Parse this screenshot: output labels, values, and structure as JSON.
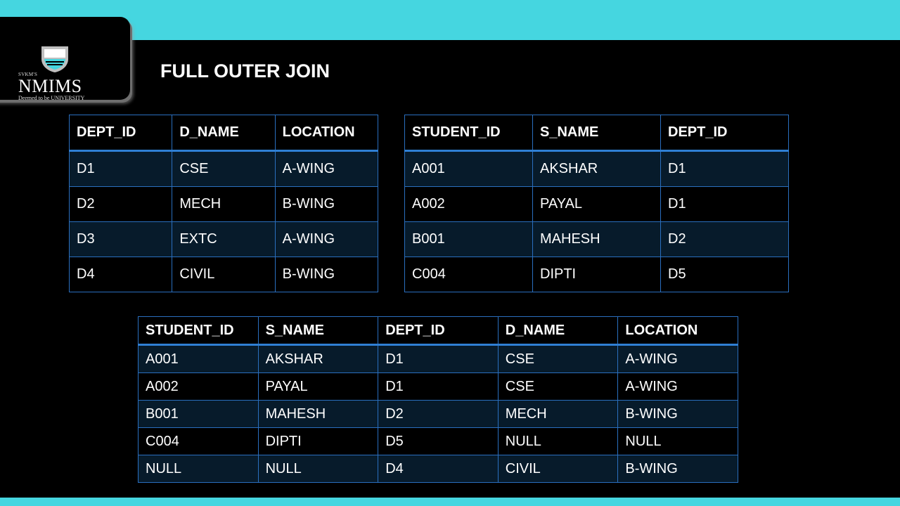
{
  "logo": {
    "svkm": "SVKM'S",
    "name": "NMIMS",
    "tagline": "Deemed to be UNIVERSITY"
  },
  "title": "FULL OUTER JOIN",
  "dept_table": {
    "headers": [
      "DEPT_ID",
      "D_NAME",
      "LOCATION"
    ],
    "rows": [
      [
        "D1",
        "CSE",
        "A-WING"
      ],
      [
        "D2",
        "MECH",
        "B-WING"
      ],
      [
        "D3",
        "EXTC",
        "A-WING"
      ],
      [
        "D4",
        "CIVIL",
        "B-WING"
      ]
    ]
  },
  "student_table": {
    "headers": [
      "STUDENT_ID",
      "S_NAME",
      "DEPT_ID"
    ],
    "rows": [
      [
        "A001",
        "AKSHAR",
        "D1"
      ],
      [
        "A002",
        "PAYAL",
        "D1"
      ],
      [
        "B001",
        "MAHESH",
        "D2"
      ],
      [
        "C004",
        "DIPTI",
        "D5"
      ]
    ]
  },
  "result_table": {
    "headers": [
      "STUDENT_ID",
      "S_NAME",
      "DEPT_ID",
      "D_NAME",
      "LOCATION"
    ],
    "rows": [
      [
        "A001",
        "AKSHAR",
        "D1",
        "CSE",
        "A-WING"
      ],
      [
        "A002",
        "PAYAL",
        "D1",
        "CSE",
        "A-WING"
      ],
      [
        "B001",
        "MAHESH",
        "D2",
        "MECH",
        "B-WING"
      ],
      [
        "C004",
        "DIPTI",
        "D5",
        "NULL",
        "NULL"
      ],
      [
        "NULL",
        "NULL",
        "D4",
        "CIVIL",
        "B-WING"
      ]
    ]
  },
  "colors": {
    "accent": "#45d6e0",
    "table_border": "#2a6fbf",
    "row_shade": "#071b2b",
    "background": "#000000"
  }
}
